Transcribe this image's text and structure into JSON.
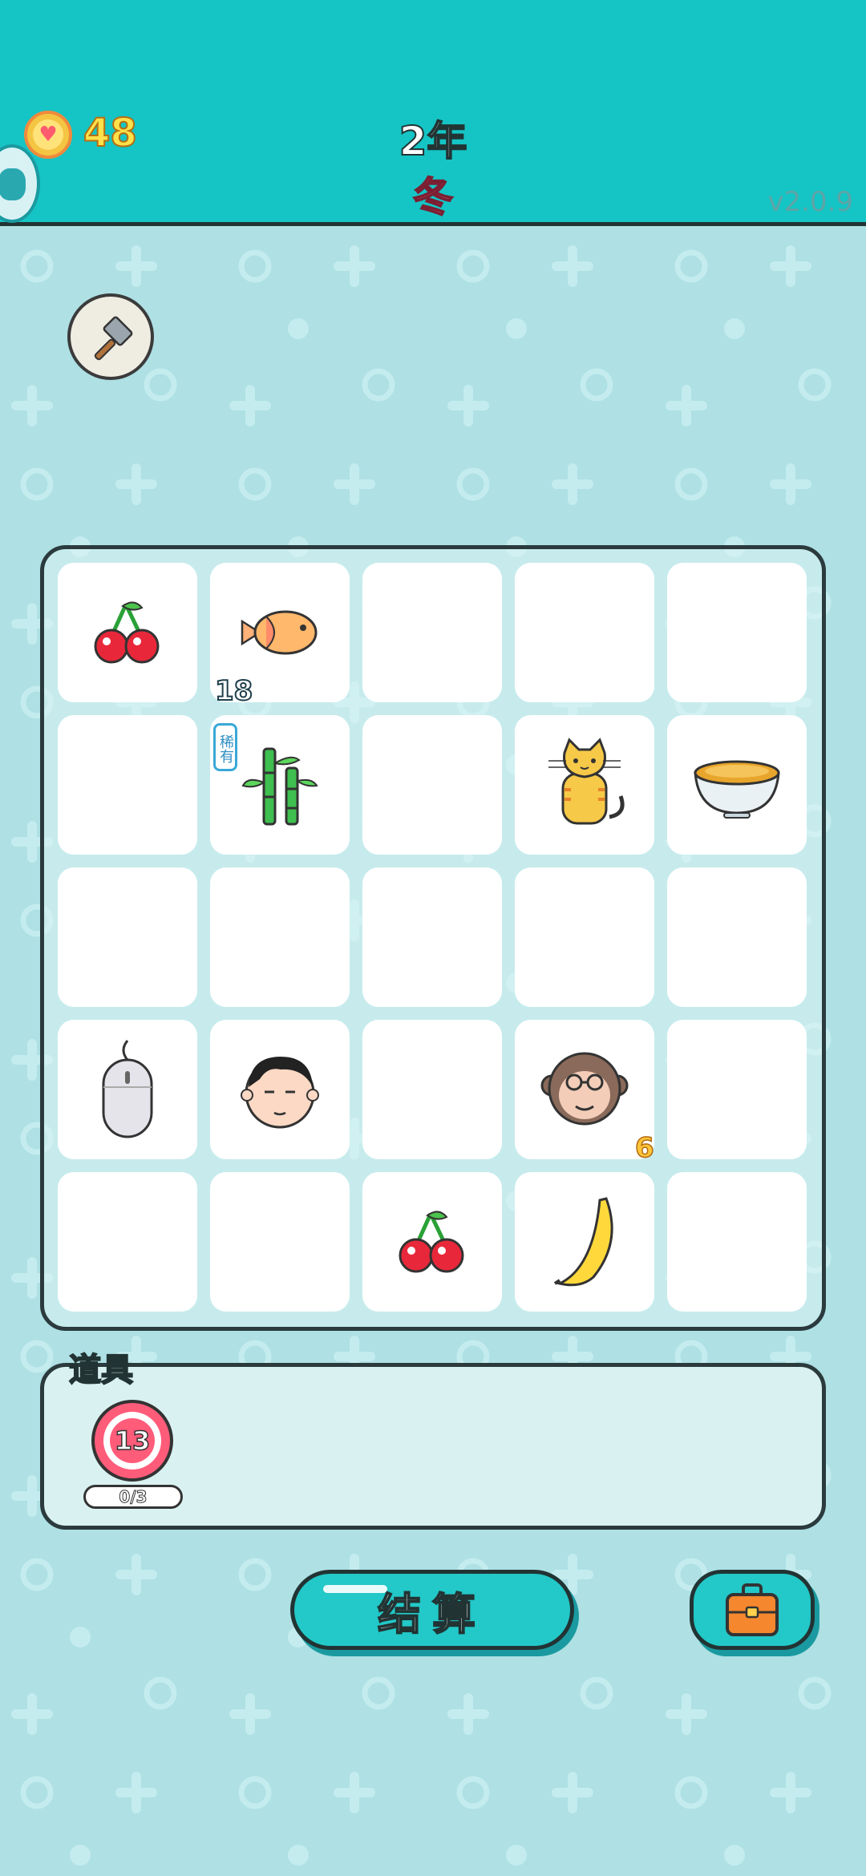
{
  "header": {
    "coins": "48",
    "year": "2年",
    "season": "冬",
    "version": "v2.0.9"
  },
  "tools": [
    {
      "name": "hammer",
      "icon": "hammer-icon"
    }
  ],
  "board": {
    "rows": 5,
    "cols": 5,
    "cells": [
      {
        "item": "cherry",
        "icon": "cherry-icon"
      },
      {
        "item": "fish",
        "icon": "fish-icon",
        "count": "18"
      },
      {
        "item": "",
        "icon": ""
      },
      {
        "item": "",
        "icon": ""
      },
      {
        "item": "",
        "icon": ""
      },
      {
        "item": "",
        "icon": ""
      },
      {
        "item": "bamboo",
        "icon": "bamboo-icon",
        "badge": "稀有"
      },
      {
        "item": "",
        "icon": ""
      },
      {
        "item": "cat",
        "icon": "cat-icon"
      },
      {
        "item": "soup",
        "icon": "soup-bowl-icon"
      },
      {
        "item": "",
        "icon": ""
      },
      {
        "item": "",
        "icon": ""
      },
      {
        "item": "",
        "icon": ""
      },
      {
        "item": "",
        "icon": ""
      },
      {
        "item": "",
        "icon": ""
      },
      {
        "item": "mouse",
        "icon": "computer-mouse-icon"
      },
      {
        "item": "man",
        "icon": "man-face-icon"
      },
      {
        "item": "",
        "icon": ""
      },
      {
        "item": "monkey",
        "icon": "monkey-icon",
        "count": "6"
      },
      {
        "item": "",
        "icon": ""
      },
      {
        "item": "",
        "icon": ""
      },
      {
        "item": "",
        "icon": ""
      },
      {
        "item": "cherry",
        "icon": "cherry-icon"
      },
      {
        "item": "banana",
        "icon": "banana-icon"
      },
      {
        "item": "",
        "icon": ""
      }
    ]
  },
  "props": {
    "label": "道具",
    "items": [
      {
        "icon": "target-icon",
        "number": "13",
        "uses": "0/3"
      }
    ]
  },
  "actions": {
    "settle_label": "结算",
    "bag_icon": "briefcase-icon"
  },
  "colors": {
    "header_bg": "#15c4c4",
    "page_bg": "#aee0e4",
    "coin_text": "#ffe14a",
    "season_text": "#ff5c7a"
  }
}
